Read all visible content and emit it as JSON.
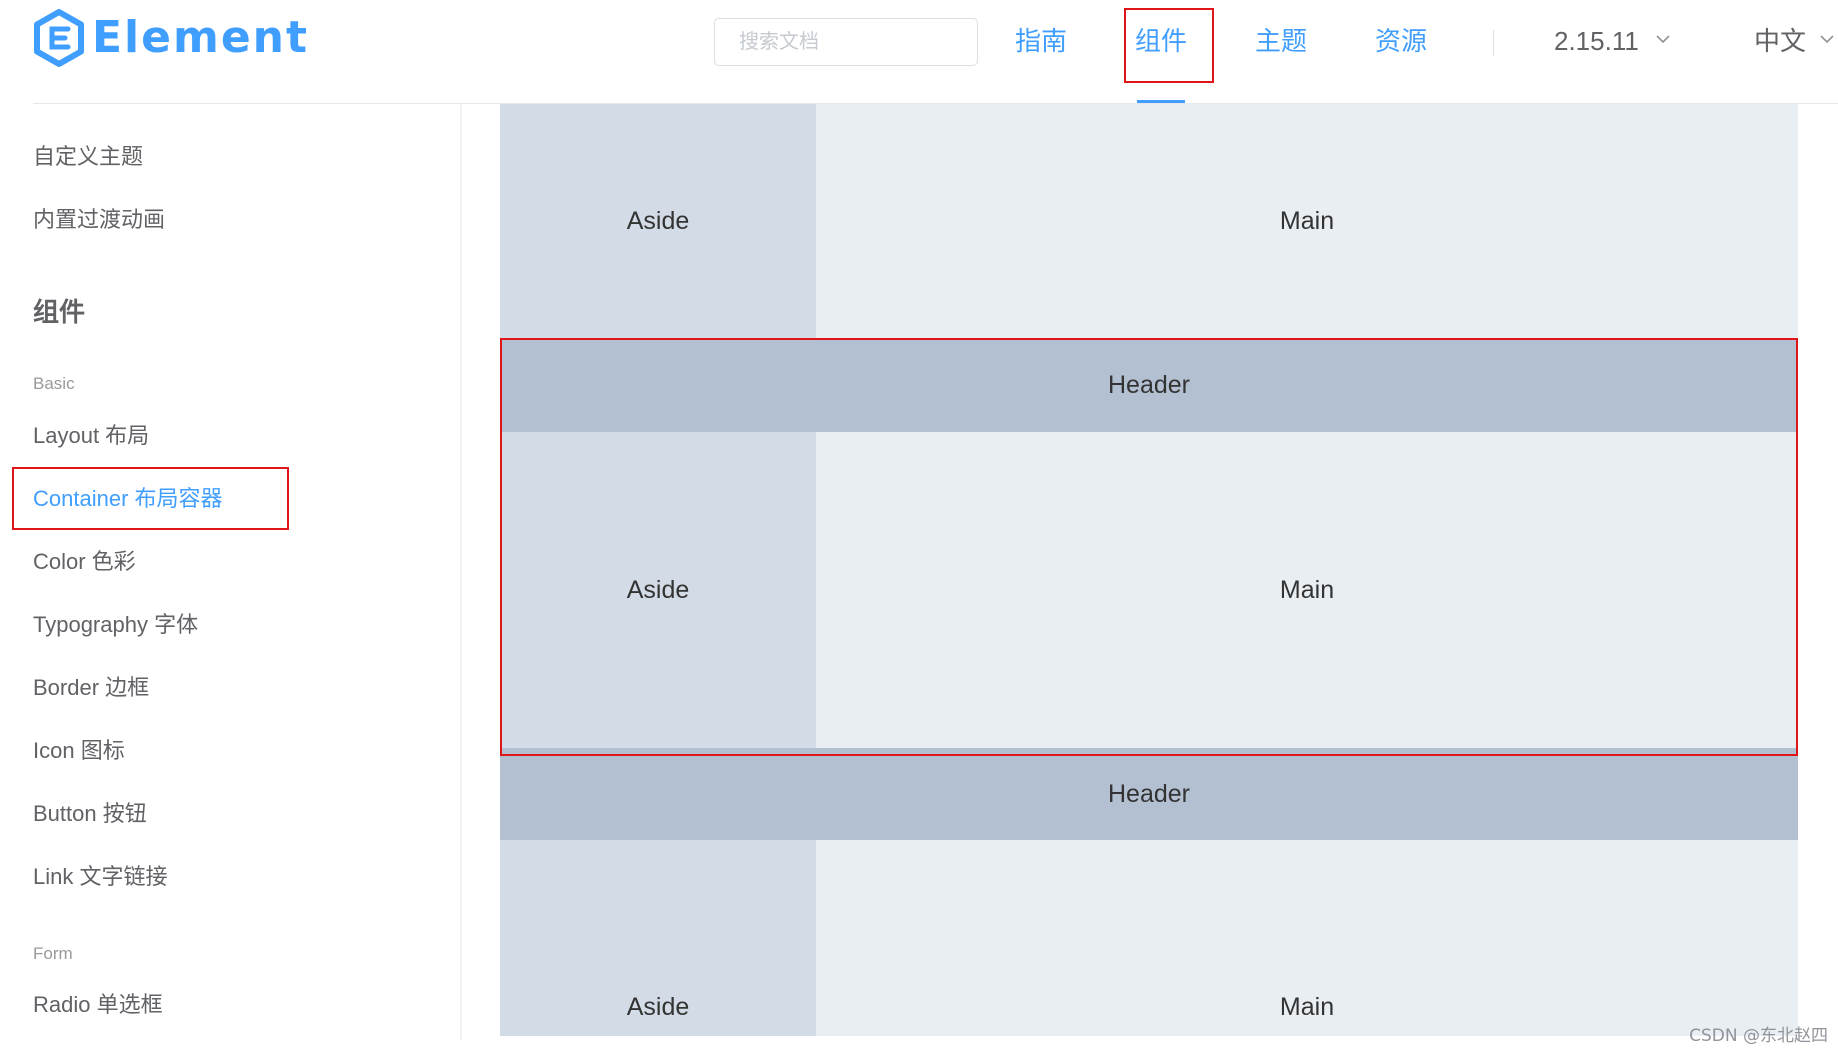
{
  "header": {
    "logo_text": "Element",
    "search_placeholder": "搜索文档",
    "nav": [
      {
        "label": "指南"
      },
      {
        "label": "组件"
      },
      {
        "label": "主题"
      },
      {
        "label": "资源"
      }
    ],
    "active_nav": "组件",
    "version": "2.15.11",
    "language": "中文"
  },
  "sidebar": {
    "top_items": [
      "自定义主题",
      "内置过渡动画"
    ],
    "group_title": "组件",
    "basic_label": "Basic",
    "basic_items": [
      "Layout 布局",
      "Container 布局容器",
      "Color 色彩",
      "Typography 字体",
      "Border 边框",
      "Icon 图标",
      "Button 按钮",
      "Link 文字链接"
    ],
    "active_item": "Container 布局容器",
    "form_label": "Form",
    "form_items": [
      "Radio 单选框"
    ]
  },
  "demo": {
    "aside": "Aside",
    "main": "Main",
    "header": "Header"
  },
  "colors": {
    "accent": "#409eff",
    "aside_bg": "#d3dce6",
    "main_bg": "#e9eef3",
    "header_bg": "#b3c0d1",
    "highlight_border": "#e0151a"
  },
  "watermark": "CSDN @东北赵四"
}
